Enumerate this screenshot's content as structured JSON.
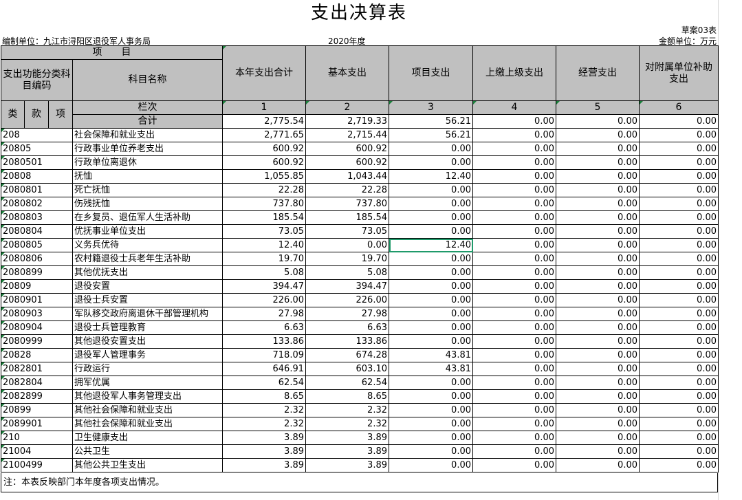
{
  "title": "支出决算表",
  "form_no": "草案03表",
  "unit": "编制单位：九江市浔阳区退役军人事务局",
  "year": "2020年度",
  "currency": "金额单位：万元",
  "header": {
    "item": "项　　目",
    "code_label": "支出功能分类科目编码",
    "name_label": "科目名称",
    "lei": "类",
    "kuan": "款",
    "xiang": "项",
    "lanci": "栏次",
    "total_label": "合计",
    "cols": [
      "本年支出合计",
      "基本支出",
      "项目支出",
      "上缴上级支出",
      "经营支出",
      "对附属单位补助支出"
    ],
    "col_nums": [
      "1",
      "2",
      "3",
      "4",
      "5",
      "6"
    ]
  },
  "total": [
    "2,775.54",
    "2,719.33",
    "56.21",
    "0.00",
    "0.00",
    "0.00"
  ],
  "rows": [
    {
      "code": "208",
      "name": "社会保障和就业支出",
      "level": 1,
      "v": [
        "2,771.65",
        "2,715.44",
        "56.21",
        "0.00",
        "0.00",
        "0.00"
      ]
    },
    {
      "code": "20805",
      "name": "行政事业单位养老支出",
      "level": 1,
      "v": [
        "600.92",
        "600.92",
        "0.00",
        "0.00",
        "0.00",
        "0.00"
      ]
    },
    {
      "code": "2080501",
      "name": "行政单位离退休",
      "level": 2,
      "v": [
        "600.92",
        "600.92",
        "0.00",
        "0.00",
        "0.00",
        "0.00"
      ]
    },
    {
      "code": "20808",
      "name": "抚恤",
      "level": 1,
      "v": [
        "1,055.85",
        "1,043.44",
        "12.40",
        "0.00",
        "0.00",
        "0.00"
      ]
    },
    {
      "code": "2080801",
      "name": "死亡抚恤",
      "level": 2,
      "v": [
        "22.28",
        "22.28",
        "0.00",
        "0.00",
        "0.00",
        "0.00"
      ]
    },
    {
      "code": "2080802",
      "name": "伤残抚恤",
      "level": 2,
      "v": [
        "737.80",
        "737.80",
        "0.00",
        "0.00",
        "0.00",
        "0.00"
      ]
    },
    {
      "code": "2080803",
      "name": "在乡复员、退伍军人生活补助",
      "level": 2,
      "v": [
        "185.54",
        "185.54",
        "0.00",
        "0.00",
        "0.00",
        "0.00"
      ]
    },
    {
      "code": "2080804",
      "name": "优抚事业单位支出",
      "level": 2,
      "v": [
        "73.05",
        "73.05",
        "0.00",
        "0.00",
        "0.00",
        "0.00"
      ]
    },
    {
      "code": "2080805",
      "name": "义务兵优待",
      "level": 2,
      "v": [
        "12.40",
        "0.00",
        "12.40",
        "0.00",
        "0.00",
        "0.00"
      ],
      "selected": true
    },
    {
      "code": "2080806",
      "name": "农村籍退役士兵老年生活补助",
      "level": 2,
      "v": [
        "19.70",
        "19.70",
        "0.00",
        "0.00",
        "0.00",
        "0.00"
      ]
    },
    {
      "code": "2080899",
      "name": "其他优抚支出",
      "level": 2,
      "v": [
        "5.08",
        "5.08",
        "0.00",
        "0.00",
        "0.00",
        "0.00"
      ]
    },
    {
      "code": "20809",
      "name": "退役安置",
      "level": 1,
      "v": [
        "394.47",
        "394.47",
        "0.00",
        "0.00",
        "0.00",
        "0.00"
      ]
    },
    {
      "code": "2080901",
      "name": "退役士兵安置",
      "level": 2,
      "v": [
        "226.00",
        "226.00",
        "0.00",
        "0.00",
        "0.00",
        "0.00"
      ]
    },
    {
      "code": "2080903",
      "name": "军队移交政府离退休干部管理机构",
      "level": 2,
      "small": true,
      "v": [
        "27.98",
        "27.98",
        "0.00",
        "0.00",
        "0.00",
        "0.00"
      ]
    },
    {
      "code": "2080904",
      "name": "退役士兵管理教育",
      "level": 2,
      "v": [
        "6.63",
        "6.63",
        "0.00",
        "0.00",
        "0.00",
        "0.00"
      ]
    },
    {
      "code": "2080999",
      "name": "其他退役安置支出",
      "level": 2,
      "v": [
        "133.86",
        "133.86",
        "0.00",
        "0.00",
        "0.00",
        "0.00"
      ]
    },
    {
      "code": "20828",
      "name": "退役军人管理事务",
      "level": 1,
      "v": [
        "718.09",
        "674.28",
        "43.81",
        "0.00",
        "0.00",
        "0.00"
      ]
    },
    {
      "code": "2082801",
      "name": "行政运行",
      "level": 2,
      "v": [
        "646.91",
        "603.10",
        "43.81",
        "0.00",
        "0.00",
        "0.00"
      ]
    },
    {
      "code": "2082804",
      "name": "拥军优属",
      "level": 2,
      "v": [
        "62.54",
        "62.54",
        "0.00",
        "0.00",
        "0.00",
        "0.00"
      ]
    },
    {
      "code": "2082899",
      "name": "其他退役军人事务管理支出",
      "level": 2,
      "v": [
        "8.65",
        "8.65",
        "0.00",
        "0.00",
        "0.00",
        "0.00"
      ]
    },
    {
      "code": "20899",
      "name": "其他社会保障和就业支出",
      "level": 1,
      "v": [
        "2.32",
        "2.32",
        "0.00",
        "0.00",
        "0.00",
        "0.00"
      ]
    },
    {
      "code": "2089901",
      "name": "其他社会保障和就业支出",
      "level": 2,
      "v": [
        "2.32",
        "2.32",
        "0.00",
        "0.00",
        "0.00",
        "0.00"
      ]
    },
    {
      "code": "210",
      "name": "卫生健康支出",
      "level": 1,
      "v": [
        "3.89",
        "3.89",
        "0.00",
        "0.00",
        "0.00",
        "0.00"
      ]
    },
    {
      "code": "21004",
      "name": "公共卫生",
      "level": 1,
      "v": [
        "3.89",
        "3.89",
        "0.00",
        "0.00",
        "0.00",
        "0.00"
      ]
    },
    {
      "code": "2100499",
      "name": "其他公共卫生支出",
      "level": 2,
      "v": [
        "3.89",
        "3.89",
        "0.00",
        "0.00",
        "0.00",
        "0.00"
      ]
    }
  ],
  "note": "注：本表反映部门本年度各项支出情况。"
}
